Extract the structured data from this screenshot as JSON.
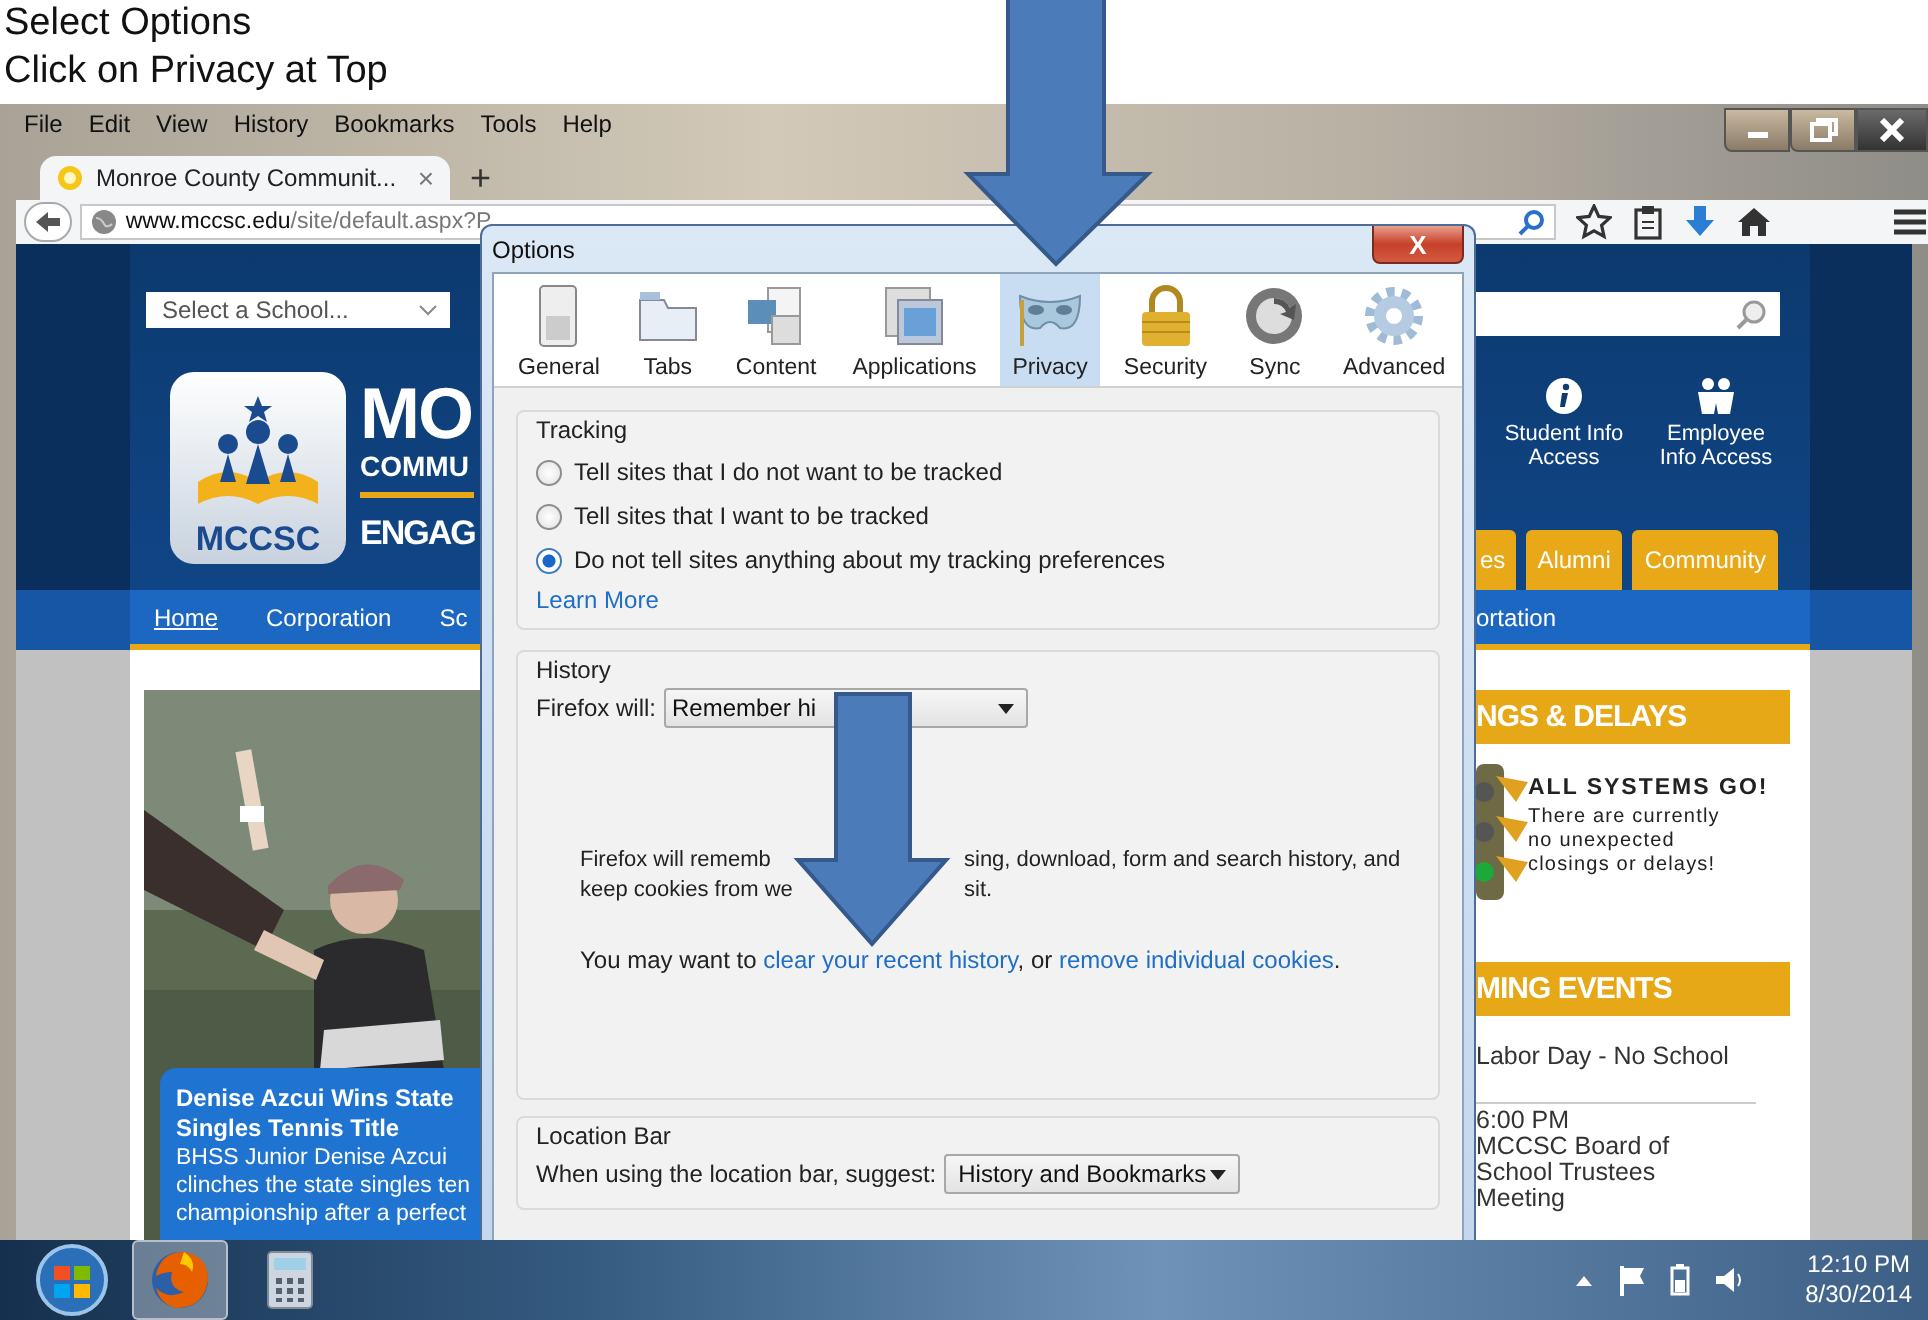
{
  "instructions": [
    "Select Options",
    "Click on Privacy at Top"
  ],
  "menu": [
    "File",
    "Edit",
    "View",
    "History",
    "Bookmarks",
    "Tools",
    "Help"
  ],
  "tab": {
    "title": "Monroe County Communit...",
    "close": "×"
  },
  "new_tab": "+",
  "address": {
    "host": "www.mccsc.edu",
    "path": "/site/default.aspx?P"
  },
  "site": {
    "school_select": "Select a School...",
    "logo_text": "MCCSC",
    "wordmark": [
      "MO",
      "COMMU",
      "ENGAG"
    ],
    "quick_links": [
      {
        "kind": "info",
        "label": "Student Info Access"
      },
      {
        "kind": "people",
        "label": "Employee Info Access"
      }
    ],
    "tabs": [
      "es",
      "Alumni",
      "Community"
    ],
    "nav": [
      {
        "label": "Home",
        "selected": true
      },
      {
        "label": "Corporation",
        "selected": false
      },
      {
        "label": "Sc",
        "selected": false
      }
    ],
    "nav_right": "ortation",
    "feature": {
      "kind": "picture",
      "title": "Denise Azcui Wins State Singles Tennis Title",
      "lines": [
        "BHSS Junior Denise Azcui",
        "clinches the state singles ten",
        "championship after a perfect"
      ]
    },
    "closings": {
      "heading": "NGS & DELAYS",
      "status": "ALL SYSTEMS GO!",
      "message": "There are currently no unexpected closings or delays!"
    },
    "events": {
      "heading": "MING EVENTS",
      "items": [
        {
          "title": "Labor Day - No School"
        },
        {
          "time": "6:00 PM",
          "title": "MCCSC Board of School Trustees Meeting"
        }
      ]
    }
  },
  "dialog": {
    "title": "Options",
    "close": "X",
    "panes": [
      {
        "kind": "general",
        "label": "General",
        "selected": false
      },
      {
        "kind": "tabs",
        "label": "Tabs",
        "selected": false
      },
      {
        "kind": "content",
        "label": "Content",
        "selected": false
      },
      {
        "kind": "applications",
        "label": "Applications",
        "selected": false
      },
      {
        "kind": "privacy",
        "label": "Privacy",
        "selected": true
      },
      {
        "kind": "security",
        "label": "Security",
        "selected": false
      },
      {
        "kind": "sync",
        "label": "Sync",
        "selected": false
      },
      {
        "kind": "advanced",
        "label": "Advanced",
        "selected": false
      }
    ],
    "tracking": {
      "heading": "Tracking",
      "options": [
        {
          "label": "Tell sites that I do not want to be tracked",
          "selected": false
        },
        {
          "label": "Tell sites that I want to be tracked",
          "selected": false
        },
        {
          "label": "Do not tell sites anything about my tracking preferences",
          "selected": true
        }
      ],
      "link": "Learn More"
    },
    "history": {
      "heading": "History",
      "label": "Firefox will:",
      "mode": "Remember hi",
      "description": [
        [
          "Firefox will rememb",
          "sing, download, form and search history, and"
        ],
        [
          "keep cookies from we",
          "sit."
        ]
      ],
      "hint": {
        "before": "You may want to ",
        "link1": "clear your recent history",
        "middle": ", or ",
        "link2": "remove individual cookies",
        "after": "."
      }
    },
    "location_bar": {
      "heading": "Location Bar",
      "label": "When using the location bar, suggest:",
      "value": "History and Bookmarks"
    }
  },
  "taskbar": {
    "apps": [
      {
        "kind": "firefox",
        "selected": true
      },
      {
        "kind": "calculator",
        "selected": false
      }
    ],
    "time": "12:10 PM",
    "date": "8/30/2014"
  }
}
